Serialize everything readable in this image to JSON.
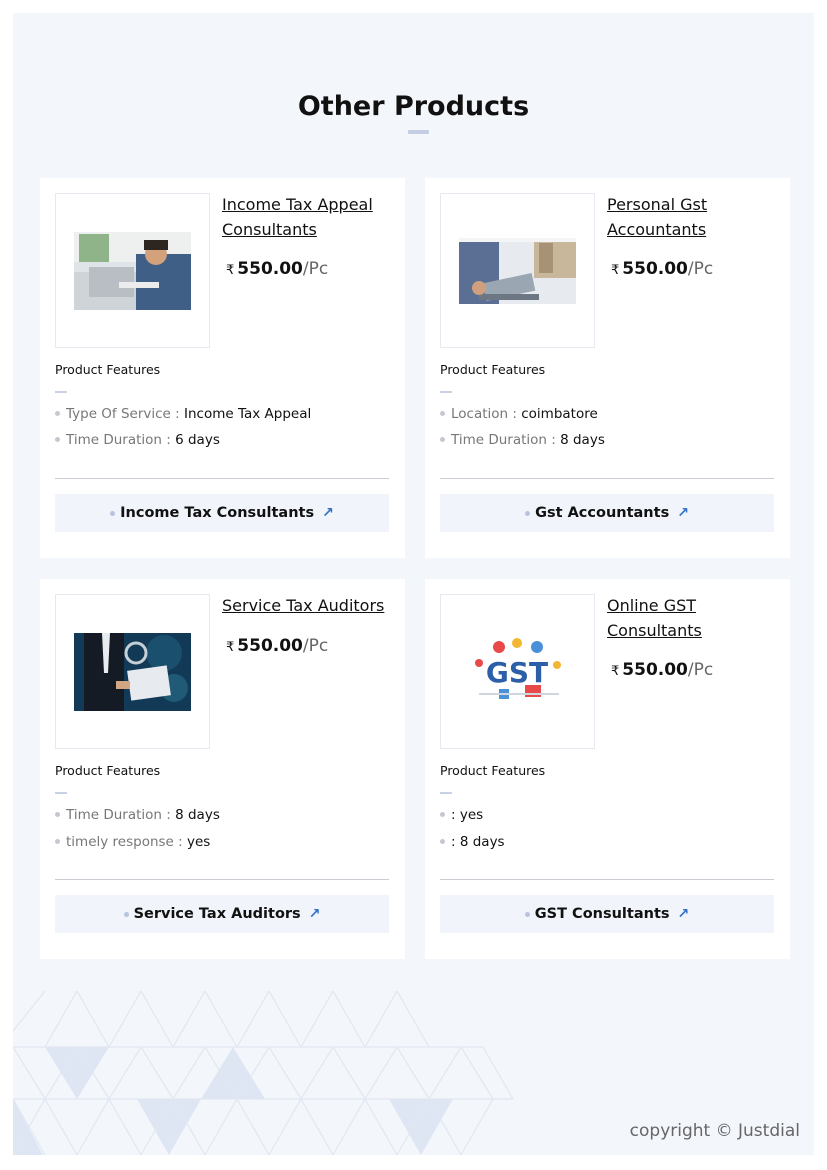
{
  "section": {
    "title": "Other Products"
  },
  "products": [
    {
      "name": "Income Tax Appeal Consultants",
      "currency": "₹",
      "price": "550.00",
      "unit": "/Pc",
      "features_title": "Product Features",
      "features": [
        {
          "key": "Type Of Service",
          "sep": " : ",
          "value": "Income Tax Appeal"
        },
        {
          "key": "Time Duration",
          "sep": " : ",
          "value": "6 days"
        }
      ],
      "button": "Income Tax Consultants"
    },
    {
      "name": "Personal Gst Accountants",
      "currency": "₹",
      "price": "550.00",
      "unit": "/Pc",
      "features_title": "Product Features",
      "features": [
        {
          "key": "Location",
          "sep": " : ",
          "value": "coimbatore"
        },
        {
          "key": "Time Duration",
          "sep": " : ",
          "value": "8 days"
        }
      ],
      "button": "Gst Accountants"
    },
    {
      "name": "Service Tax Auditors",
      "currency": "₹",
      "price": "550.00",
      "unit": "/Pc",
      "features_title": "Product Features",
      "features": [
        {
          "key": "Time Duration",
          "sep": " : ",
          "value": "8 days"
        },
        {
          "key": "timely response",
          "sep": " : ",
          "value": "yes"
        }
      ],
      "button": "Service Tax Auditors"
    },
    {
      "name": "Online GST Consultants",
      "currency": "₹",
      "price": "550.00",
      "unit": "/Pc",
      "features_title": "Product Features",
      "features": [
        {
          "key": "",
          "sep": ": ",
          "value": "yes"
        },
        {
          "key": "",
          "sep": ": ",
          "value": "8 days"
        }
      ],
      "button": "GST Consultants",
      "image_text": "GST"
    }
  ],
  "footer": {
    "copyright": "copyright © Justdial"
  },
  "colors": {
    "page_bg": "#f3f6fb",
    "accent": "#2f71c9",
    "button_bg": "#f1f4fa"
  }
}
